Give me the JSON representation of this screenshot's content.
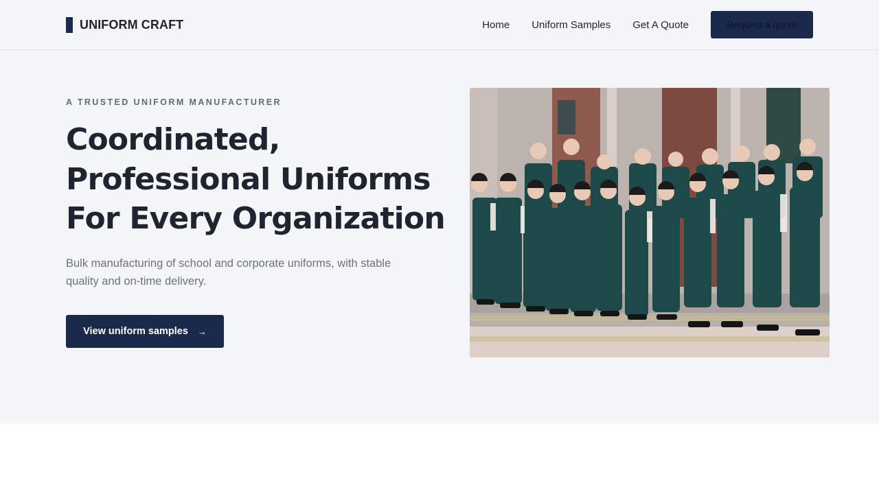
{
  "header": {
    "brand": "UNIFORM CRAFT",
    "nav": [
      "Home",
      "Uniform Samples",
      "Get A Quote"
    ],
    "cta_label": "Request a quote"
  },
  "hero": {
    "eyebrow": "A TRUSTED UNIFORM MANUFACTURER",
    "title_lines": [
      "Coordinated,",
      "Professional Uniforms",
      "For Every Organization"
    ],
    "subtitle": "Bulk manufacturing of school and corporate uniforms, with stable quality and on-time delivery.",
    "button_label": "View uniform samples",
    "button_arrow": "→"
  },
  "colors": {
    "brand_navy": "#1b2a4a",
    "hero_bg": "#f4f5f7",
    "uniform_green": "#1d4a48"
  },
  "icons": {
    "logo_mark": "navy-bar-icon",
    "button_arrow": "arrow-right-icon"
  }
}
